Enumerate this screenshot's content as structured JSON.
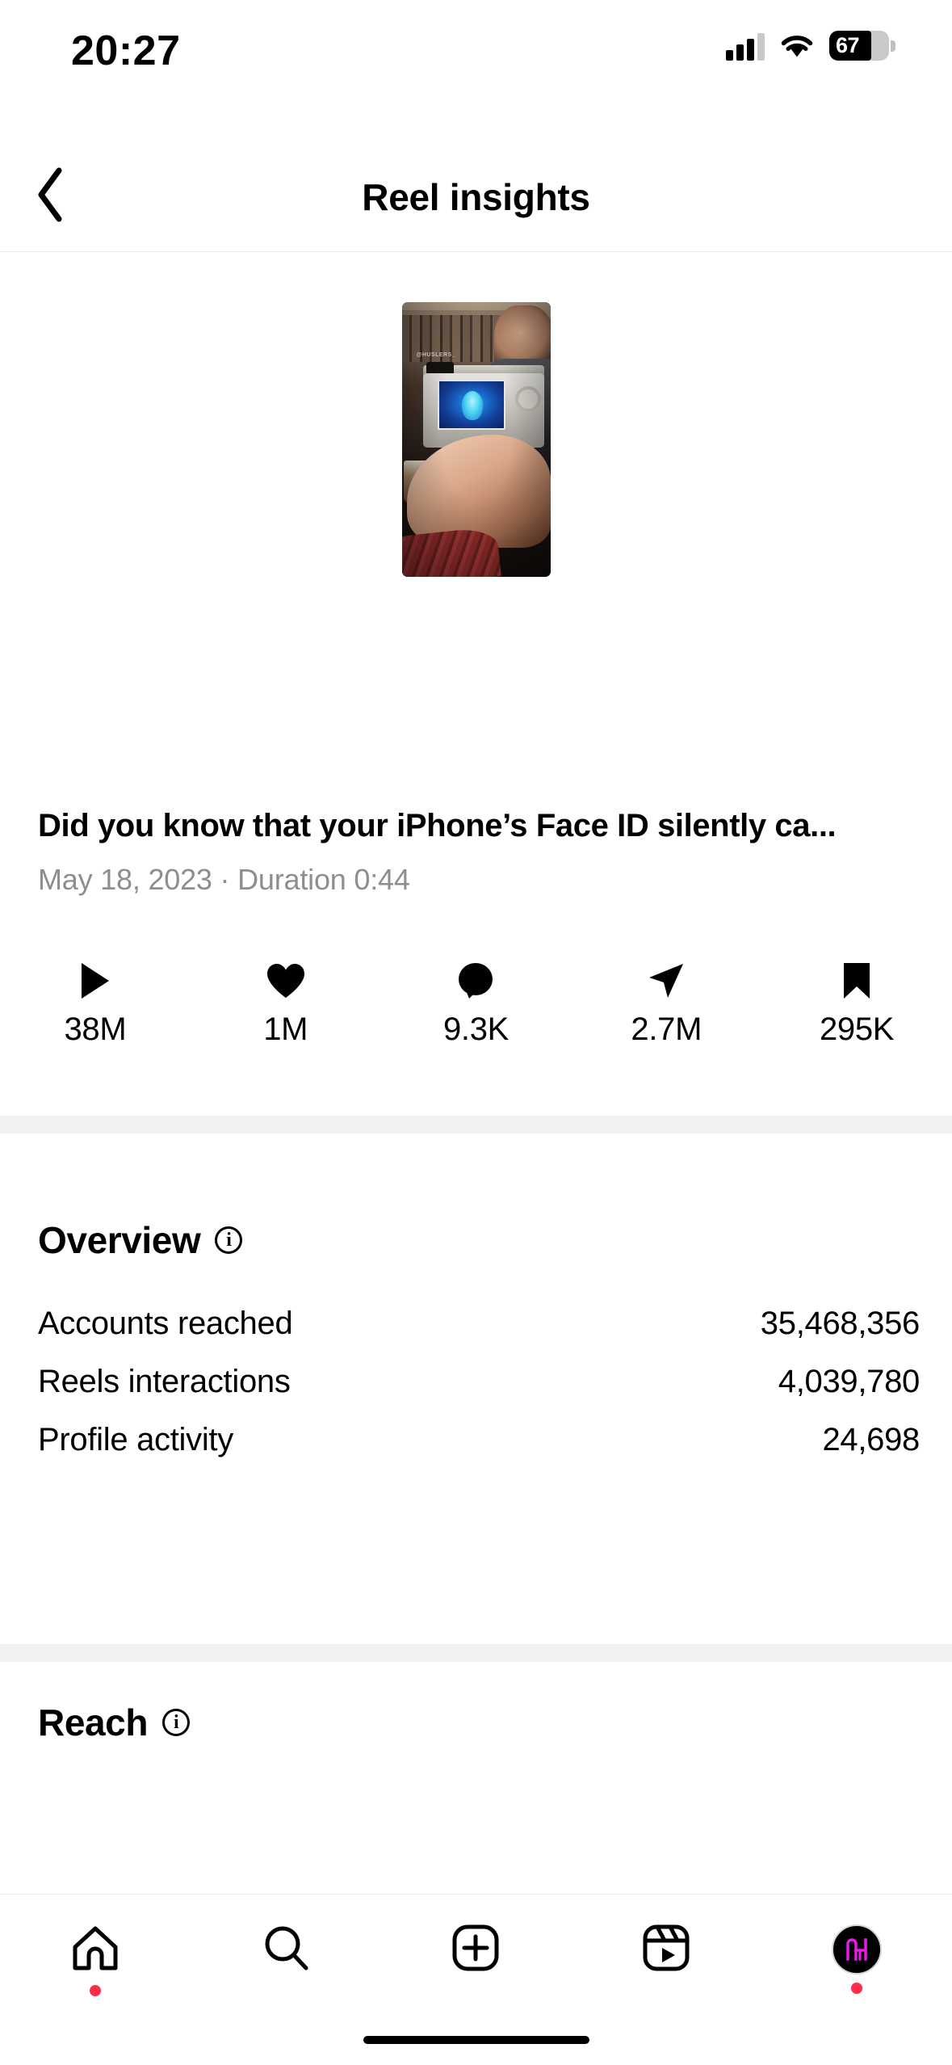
{
  "status_bar": {
    "time": "20:27",
    "battery_level": "67",
    "icons": [
      "cellular-signal-icon",
      "wifi-icon",
      "battery-icon"
    ]
  },
  "header": {
    "title": "Reel insights",
    "back_icon": "chevron-left-icon"
  },
  "post": {
    "thumbnail_watermark": "@HUSLERS_",
    "caption": "Did you know that your iPhone’s Face ID silently ca...",
    "meta": "May 18, 2023 · Duration 0:44",
    "date": "May 18, 2023",
    "duration": "0:44"
  },
  "metrics": [
    {
      "icon": "play-icon",
      "name": "plays",
      "value": "38M"
    },
    {
      "icon": "heart-icon",
      "name": "likes",
      "value": "1M"
    },
    {
      "icon": "comment-icon",
      "name": "comments",
      "value": "9.3K"
    },
    {
      "icon": "share-icon",
      "name": "shares",
      "value": "2.7M"
    },
    {
      "icon": "bookmark-icon",
      "name": "saves",
      "value": "295K"
    }
  ],
  "overview": {
    "title": "Overview",
    "info_icon": "info-circle-icon",
    "rows": [
      {
        "label": "Accounts reached",
        "value": "35,468,356"
      },
      {
        "label": "Reels interactions",
        "value": "4,039,780"
      },
      {
        "label": "Profile activity",
        "value": "24,698"
      }
    ]
  },
  "reach": {
    "title": "Reach",
    "info_icon": "info-circle-icon"
  },
  "tab_bar": {
    "tabs": [
      {
        "name": "home",
        "icon": "home-icon",
        "badge": true
      },
      {
        "name": "search",
        "icon": "search-icon",
        "badge": false
      },
      {
        "name": "create",
        "icon": "plus-box-icon",
        "badge": false
      },
      {
        "name": "reels",
        "icon": "reels-icon",
        "badge": false
      },
      {
        "name": "profile",
        "icon": "avatar-icon",
        "badge": true
      }
    ]
  },
  "colors": {
    "background": "#ffffff",
    "text": "#000000",
    "secondary_text": "#8e8e8e",
    "divider": "#f2f2f3",
    "hairline": "#ececed",
    "badge_red": "#ff2d4b",
    "avatar_logo": "#e81ce8"
  }
}
